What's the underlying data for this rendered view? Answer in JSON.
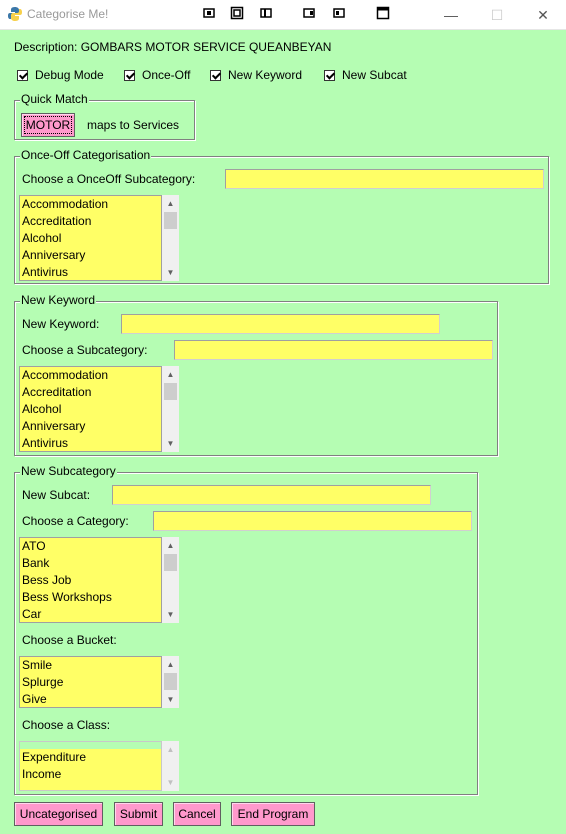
{
  "window": {
    "title": "Categorise Me!",
    "minimize_glyph": "—",
    "maximize_glyph": "☐",
    "close_glyph": "✕"
  },
  "description": "Description: GOMBARS MOTOR SERVICE QUEANBEYAN",
  "options": [
    {
      "label": "Debug Mode",
      "checked": true
    },
    {
      "label": "Once-Off",
      "checked": true
    },
    {
      "label": "New Keyword",
      "checked": true
    },
    {
      "label": "New Subcat",
      "checked": true
    }
  ],
  "quick_match": {
    "legend": "Quick Match",
    "button_label": "MOTOR",
    "maps_text": "maps to Services"
  },
  "once_off": {
    "legend": "Once-Off Categorisation",
    "subcategory_label": "Choose a OnceOff Subcategory:",
    "subcategory_value": "",
    "items": [
      "Accommodation",
      "Accreditation",
      "Alcohol",
      "Anniversary",
      "Antivirus"
    ]
  },
  "new_keyword": {
    "legend": "New Keyword",
    "keyword_label": "New Keyword:",
    "keyword_value": "",
    "subcategory_label": "Choose a Subcategory:",
    "subcategory_value": "",
    "items": [
      "Accommodation",
      "Accreditation",
      "Alcohol",
      "Anniversary",
      "Antivirus"
    ]
  },
  "new_subcategory": {
    "legend": "New Subcategory",
    "subcat_label": "New Subcat:",
    "subcat_value": "",
    "category_label": "Choose a Category:",
    "category_value": "",
    "category_items": [
      "ATO",
      "Bank",
      "Bess Job",
      "Bess Workshops",
      "Car"
    ],
    "bucket_label": "Choose a Bucket:",
    "bucket_items": [
      "Smile",
      "Splurge",
      "Give"
    ],
    "class_label": "Choose a Class:",
    "class_items": [
      "Expenditure",
      "Income"
    ]
  },
  "buttons": {
    "uncategorised": "Uncategorised",
    "submit": "Submit",
    "cancel": "Cancel",
    "end_program": "End Program"
  },
  "colors": {
    "background": "#b5fdb3",
    "field": "#ffff66",
    "button": "#ff99cc"
  }
}
